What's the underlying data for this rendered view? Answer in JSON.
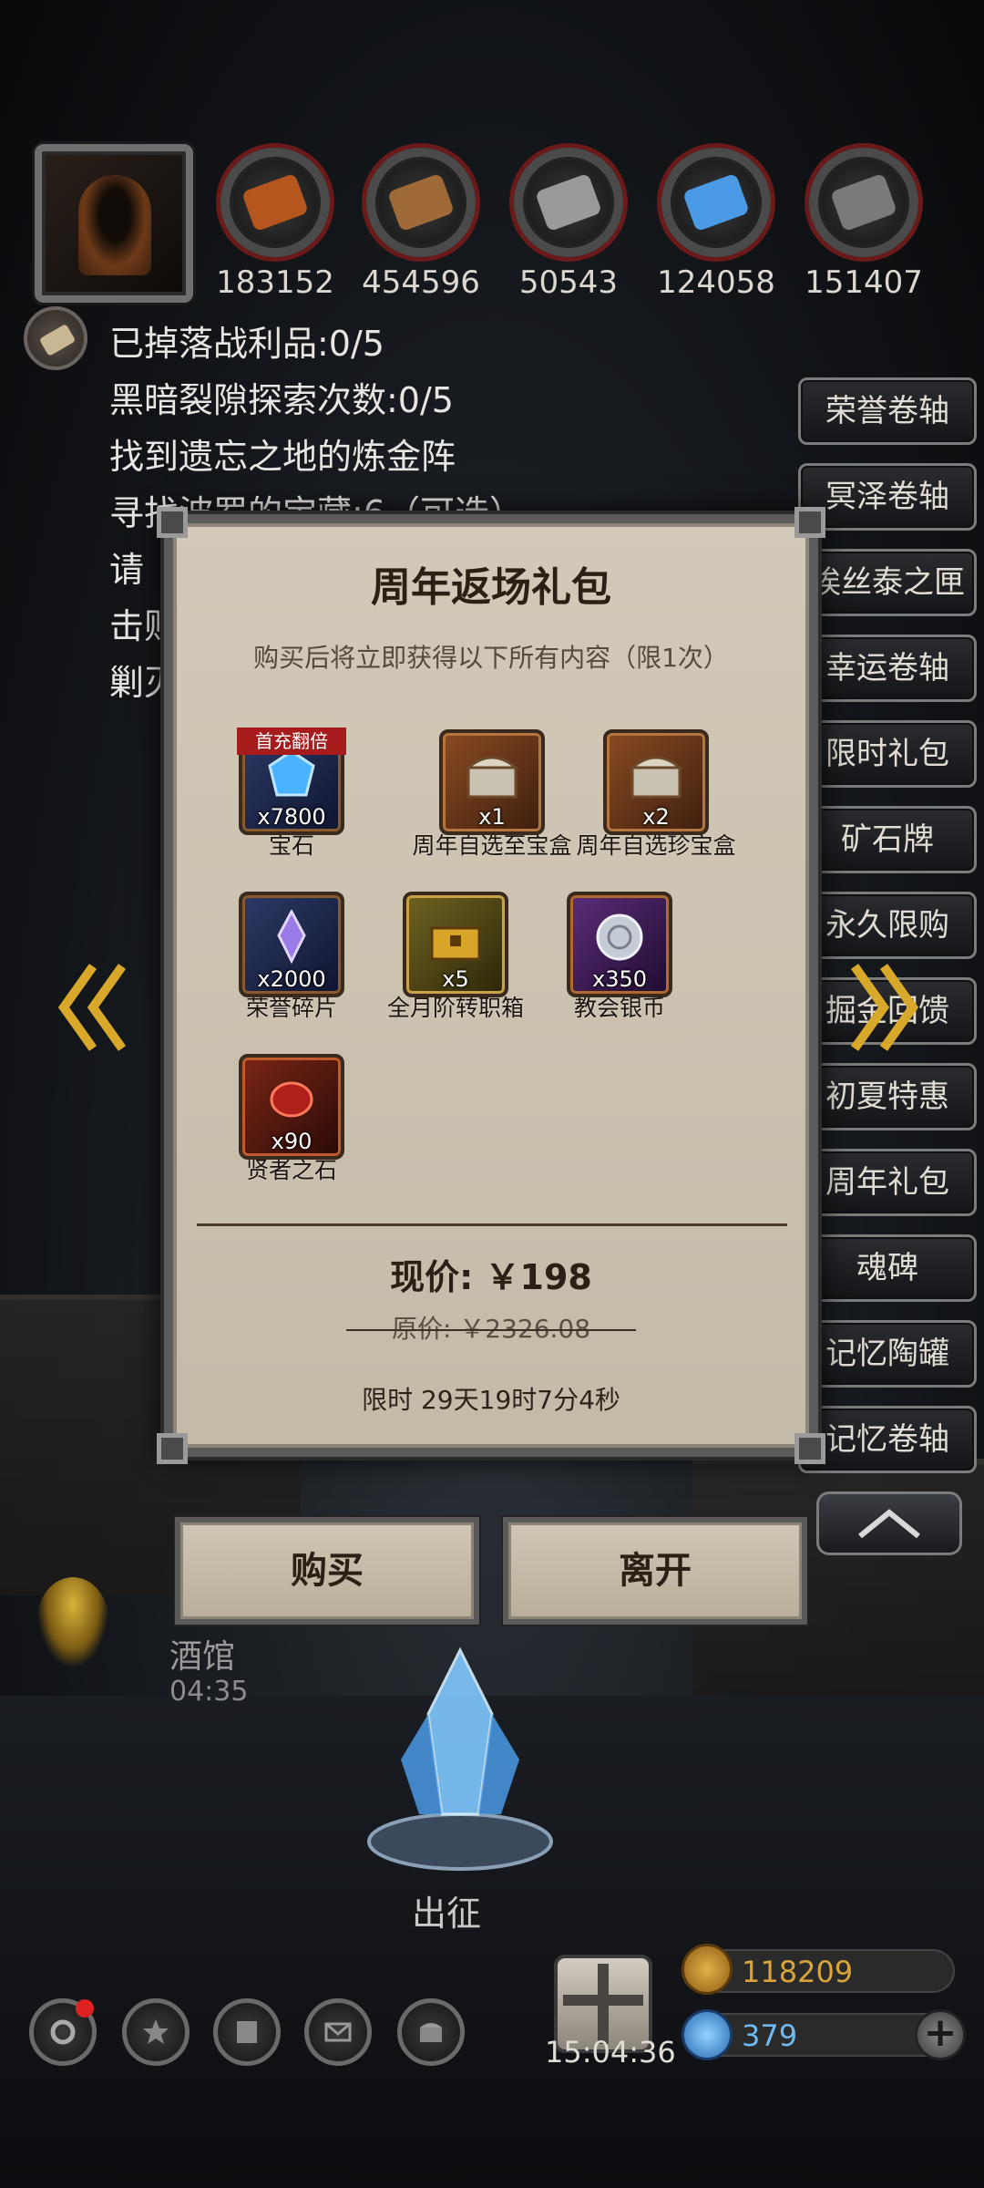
{
  "resources": [
    {
      "name": "meat-icon",
      "value": "183152",
      "color": "#b5561f"
    },
    {
      "name": "wood-icon",
      "value": "454596",
      "color": "#a06a38"
    },
    {
      "name": "iron-icon",
      "value": "50543",
      "color": "#9a9a9a"
    },
    {
      "name": "crystal-icon",
      "value": "124058",
      "color": "#4a9ae6"
    },
    {
      "name": "stone-icon",
      "value": "151407",
      "color": "#7a7a7a"
    }
  ],
  "quests": [
    "已掉落战利品:0/5",
    "黑暗裂隙探索次数:0/5",
    "找到遗忘之地的炼金阵",
    "寻找波罗的宝藏:6（可选）",
    "请",
    "击败",
    "剿灭"
  ],
  "side_menu": [
    "荣誉卷轴",
    "冥泽卷轴",
    "埃丝泰之匣",
    "幸运卷轴",
    "限时礼包",
    "矿石牌",
    "永久限购",
    "掘金回馈",
    "初夏特惠",
    "周年礼包",
    "魂碑",
    "记忆陶罐",
    "记忆卷轴"
  ],
  "dialog": {
    "title": "周年返场礼包",
    "subtitle": "购买后将立即获得以下所有内容（限1次）",
    "items": [
      {
        "name": "宝石",
        "qty": "x7800",
        "tag": "首充翻倍",
        "style": "blue"
      },
      {
        "name": "周年自选至宝盒",
        "qty": "x1",
        "tag": "",
        "style": ""
      },
      {
        "name": "周年自选珍宝盒",
        "qty": "x2",
        "tag": "",
        "style": ""
      },
      {
        "name": "荣誉碎片",
        "qty": "x2000",
        "tag": "",
        "style": "blue"
      },
      {
        "name": "全月阶转职箱",
        "qty": "x5",
        "tag": "",
        "style": "gold"
      },
      {
        "name": "教会银币",
        "qty": "x350",
        "tag": "",
        "style": "purple"
      },
      {
        "name": "贤者之石",
        "qty": "x90",
        "tag": "",
        "style": "red"
      }
    ],
    "price_now": "现价: ￥198",
    "price_old": "原价: ￥2326.08",
    "limit": "限时 29天19时7分4秒",
    "buy_label": "购买",
    "leave_label": "离开"
  },
  "tavern": {
    "name": "酒馆",
    "time": "04:35"
  },
  "expedition_label": "出征",
  "gift_time": "15:04:36",
  "currency": {
    "gold": "118209",
    "gems": "379"
  },
  "colors": {
    "accent_gold": "#d9a43a",
    "gem_blue": "#6fb9f2",
    "panel": "#c8bfae"
  }
}
